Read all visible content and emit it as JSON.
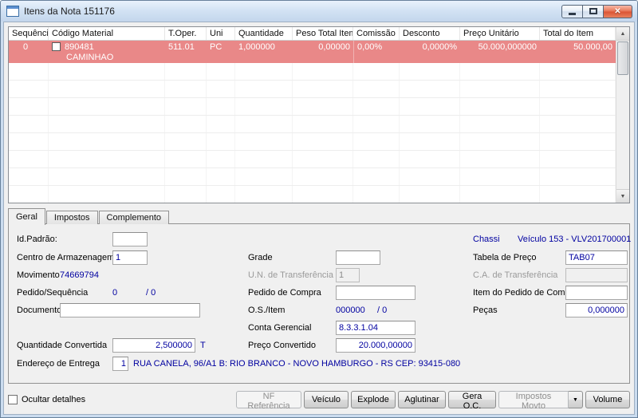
{
  "colors": {
    "selected_row_bg": "#E98888",
    "value_text": "#0000A0",
    "titlebar_top": "#E9F2FC",
    "titlebar_bottom": "#C3D6EC"
  },
  "window": {
    "title": "Itens da Nota 151176",
    "close_glyph": "✕"
  },
  "grid": {
    "columns": [
      "Sequência",
      "Código Material",
      "T.Oper.",
      "Uni",
      "Quantidade",
      "Peso Total Item",
      "Comissão",
      "Desconto",
      "Preço Unitário",
      "Total do Item"
    ],
    "rows": [
      {
        "sequencia": "0",
        "codigo_material": "890481",
        "descricao": "CAMINHAO",
        "t_oper": "511.01",
        "uni": "PC",
        "quantidade": "1,000000",
        "peso_total_item": "0,00000",
        "comissao": "0,00%",
        "desconto": "0,0000%",
        "preco_unitario": "50.000,000000",
        "total_do_item": "50.000,00"
      }
    ],
    "scroll_up_glyph": "▲",
    "scroll_down_glyph": "▼"
  },
  "tabs": [
    {
      "label": "Geral",
      "active": true
    },
    {
      "label": "Impostos",
      "active": false
    },
    {
      "label": "Complemento",
      "active": false
    }
  ],
  "form": {
    "id_padrao": {
      "label": "Id.Padrão:",
      "value": ""
    },
    "centro_armazenagem": {
      "label": "Centro de Armazenagem",
      "value": "1"
    },
    "movimento": {
      "label": "Movimento",
      "value": "74669794"
    },
    "pedido_sequencia": {
      "label": "Pedido/Sequência",
      "value": "0",
      "value2": "/ 0"
    },
    "documento": {
      "label": "Documento",
      "value": ""
    },
    "quantidade_convertida": {
      "label": "Quantidade Convertida",
      "value": "2,500000",
      "unit": "T"
    },
    "endereco_entrega": {
      "label": "Endereço de Entrega",
      "value": "1",
      "address": "RUA CANELA, 96/A1 B: RIO BRANCO - NOVO HAMBURGO - RS CEP: 93415-080"
    },
    "grade": {
      "label": "Grade",
      "value": ""
    },
    "un_transferencia": {
      "label": "U.N. de Transferência",
      "value": "1"
    },
    "pedido_compra": {
      "label": "Pedido de Compra",
      "value": ""
    },
    "os_item": {
      "label": "O.S./Item",
      "value": "000000",
      "value2": "/ 0"
    },
    "conta_gerencial": {
      "label": "Conta Gerencial",
      "value": "8.3.3.1.04"
    },
    "preco_convertido": {
      "label": "Preço Convertido",
      "value": "20.000,00000"
    },
    "chassi": {
      "label": "Chassi",
      "value": "Veículo 153 - VLV201700001"
    },
    "tabela_preco": {
      "label": "Tabela de Preço",
      "value": "TAB07"
    },
    "ca_transferencia": {
      "label": "C.A. de Transferência",
      "value": ""
    },
    "item_pedido_compra": {
      "label": "Item do Pedido de Compra",
      "value": ""
    },
    "pecas": {
      "label": "Peças",
      "value": "0,000000"
    }
  },
  "footer": {
    "ocultar_detalhes": "Ocultar detalhes",
    "buttons": {
      "nf_referencia": "NF Referência",
      "veiculo": "Veículo",
      "explode": "Explode",
      "aglutinar": "Aglutinar",
      "gera_oc": "Gera O.C.",
      "impostos_movto": "Impostos Movto",
      "dropdown": "▼",
      "volume": "Volume"
    }
  }
}
